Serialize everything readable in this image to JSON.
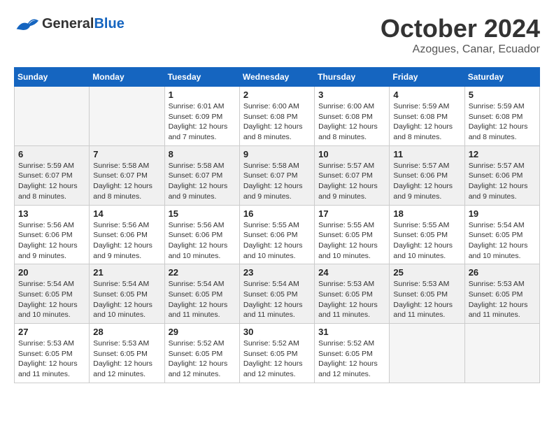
{
  "header": {
    "logo_general": "General",
    "logo_blue": "Blue",
    "month_title": "October 2024",
    "subtitle": "Azogues, Canar, Ecuador"
  },
  "weekdays": [
    "Sunday",
    "Monday",
    "Tuesday",
    "Wednesday",
    "Thursday",
    "Friday",
    "Saturday"
  ],
  "weeks": [
    [
      {
        "day": "",
        "detail": ""
      },
      {
        "day": "",
        "detail": ""
      },
      {
        "day": "1",
        "detail": "Sunrise: 6:01 AM\nSunset: 6:09 PM\nDaylight: 12 hours and 7 minutes."
      },
      {
        "day": "2",
        "detail": "Sunrise: 6:00 AM\nSunset: 6:08 PM\nDaylight: 12 hours and 8 minutes."
      },
      {
        "day": "3",
        "detail": "Sunrise: 6:00 AM\nSunset: 6:08 PM\nDaylight: 12 hours and 8 minutes."
      },
      {
        "day": "4",
        "detail": "Sunrise: 5:59 AM\nSunset: 6:08 PM\nDaylight: 12 hours and 8 minutes."
      },
      {
        "day": "5",
        "detail": "Sunrise: 5:59 AM\nSunset: 6:08 PM\nDaylight: 12 hours and 8 minutes."
      }
    ],
    [
      {
        "day": "6",
        "detail": "Sunrise: 5:59 AM\nSunset: 6:07 PM\nDaylight: 12 hours and 8 minutes."
      },
      {
        "day": "7",
        "detail": "Sunrise: 5:58 AM\nSunset: 6:07 PM\nDaylight: 12 hours and 8 minutes."
      },
      {
        "day": "8",
        "detail": "Sunrise: 5:58 AM\nSunset: 6:07 PM\nDaylight: 12 hours and 9 minutes."
      },
      {
        "day": "9",
        "detail": "Sunrise: 5:58 AM\nSunset: 6:07 PM\nDaylight: 12 hours and 9 minutes."
      },
      {
        "day": "10",
        "detail": "Sunrise: 5:57 AM\nSunset: 6:07 PM\nDaylight: 12 hours and 9 minutes."
      },
      {
        "day": "11",
        "detail": "Sunrise: 5:57 AM\nSunset: 6:06 PM\nDaylight: 12 hours and 9 minutes."
      },
      {
        "day": "12",
        "detail": "Sunrise: 5:57 AM\nSunset: 6:06 PM\nDaylight: 12 hours and 9 minutes."
      }
    ],
    [
      {
        "day": "13",
        "detail": "Sunrise: 5:56 AM\nSunset: 6:06 PM\nDaylight: 12 hours and 9 minutes."
      },
      {
        "day": "14",
        "detail": "Sunrise: 5:56 AM\nSunset: 6:06 PM\nDaylight: 12 hours and 9 minutes."
      },
      {
        "day": "15",
        "detail": "Sunrise: 5:56 AM\nSunset: 6:06 PM\nDaylight: 12 hours and 10 minutes."
      },
      {
        "day": "16",
        "detail": "Sunrise: 5:55 AM\nSunset: 6:06 PM\nDaylight: 12 hours and 10 minutes."
      },
      {
        "day": "17",
        "detail": "Sunrise: 5:55 AM\nSunset: 6:05 PM\nDaylight: 12 hours and 10 minutes."
      },
      {
        "day": "18",
        "detail": "Sunrise: 5:55 AM\nSunset: 6:05 PM\nDaylight: 12 hours and 10 minutes."
      },
      {
        "day": "19",
        "detail": "Sunrise: 5:54 AM\nSunset: 6:05 PM\nDaylight: 12 hours and 10 minutes."
      }
    ],
    [
      {
        "day": "20",
        "detail": "Sunrise: 5:54 AM\nSunset: 6:05 PM\nDaylight: 12 hours and 10 minutes."
      },
      {
        "day": "21",
        "detail": "Sunrise: 5:54 AM\nSunset: 6:05 PM\nDaylight: 12 hours and 10 minutes."
      },
      {
        "day": "22",
        "detail": "Sunrise: 5:54 AM\nSunset: 6:05 PM\nDaylight: 12 hours and 11 minutes."
      },
      {
        "day": "23",
        "detail": "Sunrise: 5:54 AM\nSunset: 6:05 PM\nDaylight: 12 hours and 11 minutes."
      },
      {
        "day": "24",
        "detail": "Sunrise: 5:53 AM\nSunset: 6:05 PM\nDaylight: 12 hours and 11 minutes."
      },
      {
        "day": "25",
        "detail": "Sunrise: 5:53 AM\nSunset: 6:05 PM\nDaylight: 12 hours and 11 minutes."
      },
      {
        "day": "26",
        "detail": "Sunrise: 5:53 AM\nSunset: 6:05 PM\nDaylight: 12 hours and 11 minutes."
      }
    ],
    [
      {
        "day": "27",
        "detail": "Sunrise: 5:53 AM\nSunset: 6:05 PM\nDaylight: 12 hours and 11 minutes."
      },
      {
        "day": "28",
        "detail": "Sunrise: 5:53 AM\nSunset: 6:05 PM\nDaylight: 12 hours and 12 minutes."
      },
      {
        "day": "29",
        "detail": "Sunrise: 5:52 AM\nSunset: 6:05 PM\nDaylight: 12 hours and 12 minutes."
      },
      {
        "day": "30",
        "detail": "Sunrise: 5:52 AM\nSunset: 6:05 PM\nDaylight: 12 hours and 12 minutes."
      },
      {
        "day": "31",
        "detail": "Sunrise: 5:52 AM\nSunset: 6:05 PM\nDaylight: 12 hours and 12 minutes."
      },
      {
        "day": "",
        "detail": ""
      },
      {
        "day": "",
        "detail": ""
      }
    ]
  ]
}
